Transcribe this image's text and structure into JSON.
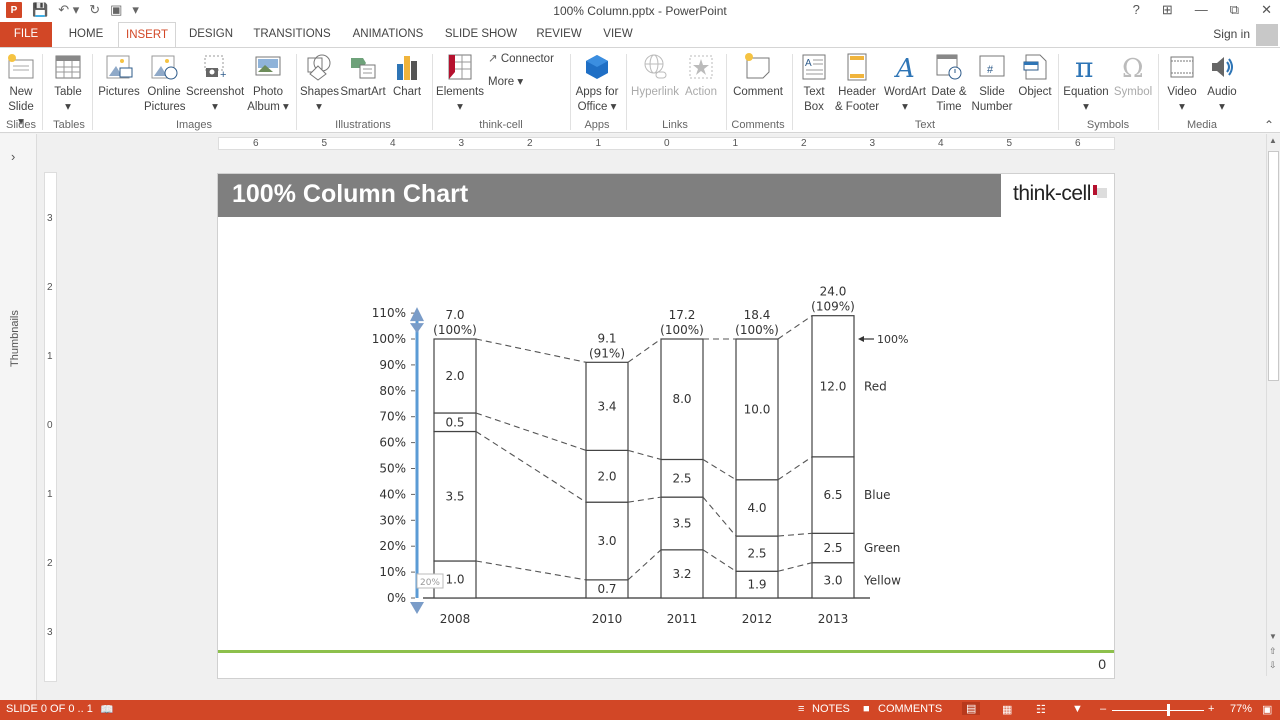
{
  "window": {
    "title": "100% Column.pptx - PowerPoint",
    "controls": [
      "?",
      "ribbon-display-options",
      "minimize",
      "restore",
      "close"
    ]
  },
  "qat": {
    "save": "save-icon",
    "undo": "undo-icon",
    "redo": "redo-icon",
    "present": "present-icon"
  },
  "tabs": [
    {
      "label": "FILE"
    },
    {
      "label": "HOME"
    },
    {
      "label": "INSERT",
      "active": true
    },
    {
      "label": "DESIGN"
    },
    {
      "label": "TRANSITIONS"
    },
    {
      "label": "ANIMATIONS"
    },
    {
      "label": "SLIDE SHOW"
    },
    {
      "label": "REVIEW"
    },
    {
      "label": "VIEW"
    }
  ],
  "signin": "Sign in",
  "ribbon": {
    "groups": [
      {
        "name": "Slides",
        "buttons": [
          {
            "label": "New",
            "label2": "Slide ▾"
          }
        ]
      },
      {
        "name": "Tables",
        "buttons": [
          {
            "label": "Table",
            "label2": "▾"
          }
        ]
      },
      {
        "name": "Images",
        "buttons": [
          {
            "label": "Pictures",
            "label2": ""
          },
          {
            "label": "Online",
            "label2": "Pictures"
          },
          {
            "label": "Screenshot",
            "label2": "▾"
          },
          {
            "label": "Photo",
            "label2": "Album ▾"
          }
        ]
      },
      {
        "name": "Illustrations",
        "buttons": [
          {
            "label": "Shapes",
            "label2": "▾"
          },
          {
            "label": "SmartArt",
            "label2": ""
          },
          {
            "label": "Chart",
            "label2": ""
          }
        ]
      },
      {
        "name": "think-cell",
        "buttons": [
          {
            "label": "Elements",
            "label2": "▾"
          },
          {
            "label": "Connector"
          },
          {
            "label": "More ▾"
          }
        ]
      },
      {
        "name": "Apps",
        "buttons": [
          {
            "label": "Apps for",
            "label2": "Office ▾"
          }
        ]
      },
      {
        "name": "Links",
        "buttons": [
          {
            "label": "Hyperlink",
            "label2": "",
            "disabled": true
          },
          {
            "label": "Action",
            "label2": "",
            "disabled": true
          }
        ]
      },
      {
        "name": "Comments",
        "buttons": [
          {
            "label": "Comment",
            "label2": ""
          }
        ]
      },
      {
        "name": "Text",
        "buttons": [
          {
            "label": "Text",
            "label2": "Box"
          },
          {
            "label": "Header",
            "label2": "& Footer"
          },
          {
            "label": "WordArt",
            "label2": "▾"
          },
          {
            "label": "Date &",
            "label2": "Time"
          },
          {
            "label": "Slide",
            "label2": "Number"
          },
          {
            "label": "Object",
            "label2": ""
          }
        ]
      },
      {
        "name": "Symbols",
        "buttons": [
          {
            "label": "Equation",
            "label2": "▾"
          },
          {
            "label": "Symbol",
            "label2": "",
            "disabled": true
          }
        ]
      },
      {
        "name": "Media",
        "buttons": [
          {
            "label": "Video",
            "label2": "▾"
          },
          {
            "label": "Audio",
            "label2": "▾"
          }
        ]
      }
    ]
  },
  "leftpane": {
    "label": "Thumbnails",
    "expand": "›"
  },
  "hruler": [
    "6",
    "5",
    "4",
    "3",
    "2",
    "1",
    "0",
    "1",
    "2",
    "3",
    "4",
    "5",
    "6"
  ],
  "vruler": [
    "3",
    "2",
    "1",
    "0",
    "1",
    "2",
    "3"
  ],
  "slide": {
    "title": "100% Column Chart",
    "logo": "think-cell",
    "page_number": "0"
  },
  "chart_data": {
    "type": "bar",
    "subtype": "100% stacked column with absolute totals",
    "categories": [
      "2008",
      "2010",
      "2011",
      "2012",
      "2013"
    ],
    "series": [
      {
        "name": "Yellow",
        "values": [
          1.0,
          0.7,
          3.2,
          1.9,
          3.0
        ]
      },
      {
        "name": "Green",
        "values": [
          3.5,
          3.0,
          3.5,
          2.5,
          2.5
        ]
      },
      {
        "name": "Blue",
        "values": [
          0.5,
          2.0,
          2.5,
          4.0,
          6.5
        ]
      },
      {
        "name": "Red",
        "values": [
          2.0,
          3.4,
          8.0,
          10.0,
          12.0
        ]
      }
    ],
    "totals": [
      "7.0",
      "9.1",
      "17.2",
      "18.4",
      "24.0"
    ],
    "total_percent": [
      "(100%)",
      "(91%)",
      "(100%)",
      "(100%)",
      "(109%)"
    ],
    "column_height_percent": [
      100,
      91,
      100,
      100,
      109
    ],
    "segment_labels": [
      [
        "1.0",
        "3.5",
        "0.5",
        "2.0"
      ],
      [
        "0.7",
        "3.0",
        "2.0",
        "3.4"
      ],
      [
        "3.2",
        "3.5",
        "2.5",
        "8.0"
      ],
      [
        "1.9",
        "2.5",
        "4.0",
        "10.0"
      ],
      [
        "3.0",
        "2.5",
        "6.5",
        "12.0"
      ]
    ],
    "y_ticks": [
      "0%",
      "10%",
      "20%",
      "30%",
      "40%",
      "50%",
      "60%",
      "70%",
      "80%",
      "90%",
      "100%",
      "110%"
    ],
    "ylim": [
      0,
      110
    ],
    "reference_line_label": "100%",
    "legend_placement": "right",
    "connectors": "dashed",
    "drag_tooltip": "20%",
    "title": "",
    "xlabel": "",
    "ylabel": ""
  },
  "statusbar": {
    "slide_info": "SLIDE 0 OF 0 .. 1",
    "notes": "NOTES",
    "comments": "COMMENTS",
    "zoom": "77%",
    "zoom_fraction": 0.77
  }
}
